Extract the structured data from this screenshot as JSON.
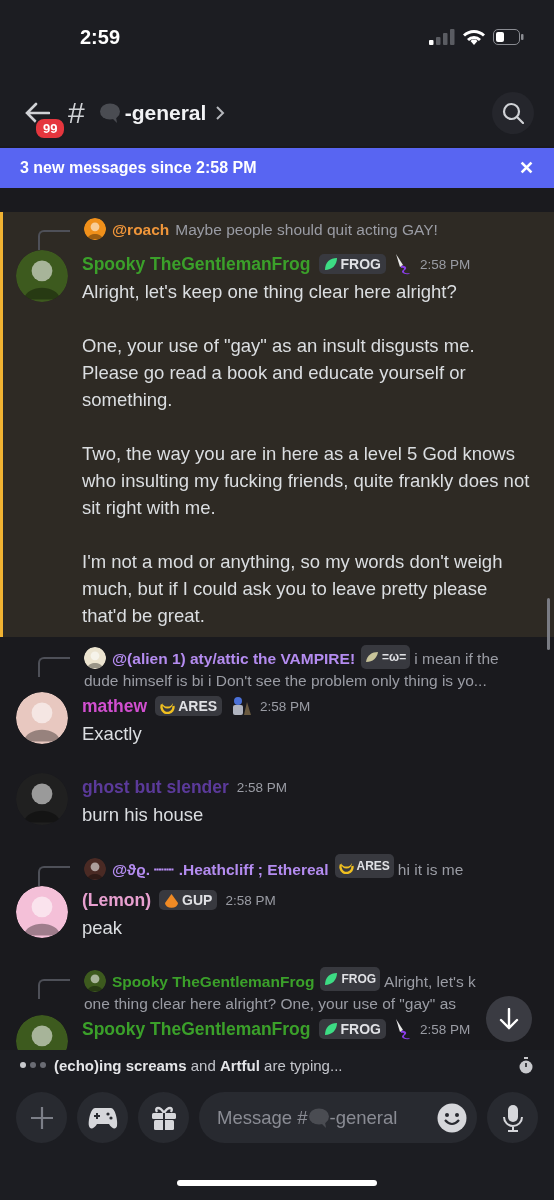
{
  "status_bar": {
    "time": "2:59"
  },
  "header": {
    "unread_badge": "99",
    "hash": "#",
    "channel": "-general"
  },
  "banner": {
    "text": "3 new messages since 2:58 PM",
    "close": "✕"
  },
  "messages": [
    {
      "highlighted": true,
      "author": "Spooky TheGentlemanFrog",
      "color": "#3ba02a",
      "tag": {
        "label": "FROG"
      },
      "time": "2:58 PM",
      "reply": {
        "author": "@roach",
        "color": "#f0963a",
        "text": [
          "Maybe people should quit acting GAY!"
        ]
      },
      "body": [
        "Alright, let's keep one thing clear here alright?",
        "One, your use of \"gay\" as an insult disgusts me. Please go read a book and educate yourself or something.",
        "Two, the way you are in here as a level 5 God knows who insulting my fucking friends, quite frankly does not sit right with me.",
        "I'm not a mod or anything, so my words don't weigh much, but if I could ask you to leave pretty please that'd be great."
      ]
    },
    {
      "author": "mathew",
      "color": "#d14fd0",
      "tag": {
        "label": "ARES"
      },
      "time": "2:58 PM",
      "reply": {
        "author": "@(alien 1) aty/attic the VAMPIRE!",
        "color": "#b48cf0",
        "tag": {
          "label": "=ω="
        },
        "text": [
          "i mean if the",
          "dude himself is bi i Don't see the problem   only thing is yo..."
        ]
      },
      "body": [
        "Exactly"
      ]
    },
    {
      "author": "ghost but slender",
      "color": "#5b3a9a",
      "time": "2:58 PM",
      "body": [
        "burn his house"
      ]
    },
    {
      "author": "(Lemon)",
      "color": "#e8a0d0",
      "tag": {
        "label": "GUP"
      },
      "time": "2:58 PM",
      "reply": {
        "author": "@ϑϱ. ┈┈ .Heathcliff ; Ethereal",
        "color": "#b48cf0",
        "tag": {
          "label": "ARES"
        },
        "text": [
          "hi it is me"
        ]
      },
      "body": [
        "peak"
      ]
    },
    {
      "author": "Spooky TheGentlemanFrog",
      "color": "#3ba02a",
      "tag": {
        "label": "FROG"
      },
      "time": "2:58 PM",
      "reply": {
        "author": "Spooky TheGentlemanFrog",
        "color": "#3ba02a",
        "tag": {
          "label": "FROG"
        },
        "text": [
          "Alright, let's k",
          "one thing clear here alright?  One, your use of \"gay\" as"
        ]
      }
    }
  ],
  "typing": {
    "text": "**(echo)ing screams** and **Artful** are typing..."
  },
  "composer": {
    "placeholder_start": "Message #",
    "placeholder_end": "-general"
  }
}
